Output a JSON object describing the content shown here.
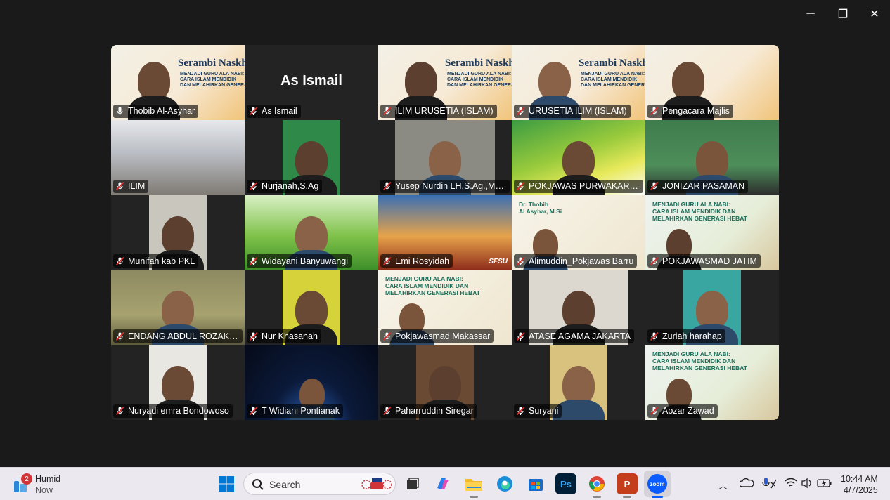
{
  "window": {
    "controls": {
      "minimize": "─",
      "maximize": "❐",
      "close": "✕"
    }
  },
  "meeting": {
    "highlight_color": "#35d07f",
    "participants": [
      {
        "name": "Thobib Al-Asyhar",
        "mic": "unmuted",
        "active": true,
        "bg": "banner",
        "banner_title": "Serambi Naskhah",
        "banner_sub": "MENJADI GURU ALA NABI:\nCARA ISLAM MENDIDIK\nDAN MELAHIRKAN GENERASI HEBAT"
      },
      {
        "name": "As Ismail",
        "mic": "muted",
        "active": false,
        "bg": "plain",
        "big_label": "As Ismail"
      },
      {
        "name": "ILIM URUSETIA (ISLAM)",
        "mic": "muted",
        "active": false,
        "bg": "banner",
        "banner_title": "Serambi Naskhah",
        "banner_sub": "MENJADI GURU ALA NABI:\nCARA ISLAM MENDIDIK\nDAN MELAHIRKAN GENERASI HEBAT"
      },
      {
        "name": "URUSETIA ILIM (ISLAM)",
        "mic": "muted",
        "active": false,
        "bg": "banner",
        "banner_title": "Serambi Naskhah",
        "banner_sub": "MENJADI GURU ALA NABI:\nCARA ISLAM MENDIDIK\nDAN MELAHIRKAN GENERASI HEBAT"
      },
      {
        "name": "Pengacara Majlis",
        "mic": "muted",
        "active": false,
        "bg": "banner-person"
      },
      {
        "name": "ILIM",
        "mic": "muted",
        "active": false,
        "bg": "hall"
      },
      {
        "name": "Nurjanah,S.Ag",
        "mic": "muted",
        "active": false,
        "bg": "narrow-green"
      },
      {
        "name": "Yusep Nurdin LH,S.Ag.,M.Pd....",
        "mic": "muted",
        "active": false,
        "bg": "narrow-room"
      },
      {
        "name": "POKJAWAS PURWAKARTA",
        "mic": "muted",
        "active": false,
        "bg": "green-wave"
      },
      {
        "name": "JONIZAR PASAMAN",
        "mic": "muted",
        "active": false,
        "bg": "room-green"
      },
      {
        "name": "Munifah kab PKL",
        "mic": "muted",
        "active": false,
        "bg": "narrow-hijab"
      },
      {
        "name": "Widayani Banyuwangi",
        "mic": "muted",
        "active": false,
        "bg": "grass"
      },
      {
        "name": "Emi Rosyidah",
        "mic": "muted",
        "active": false,
        "bg": "bridge",
        "corner_label": "SFSU"
      },
      {
        "name": "Alimuddin_Pokjawas Barru",
        "mic": "muted",
        "active": false,
        "bg": "poster",
        "banner_title": "Dr. Thobib\nAl Asyhar, M.Si"
      },
      {
        "name": "POKJAWASMAD JATIM",
        "mic": "muted",
        "active": false,
        "bg": "poster-person",
        "banner_title": "MENJADI GURU ALA NABI:\nCARA ISLAM MENDIDIK DAN\nMELAHIRKAN GENERASI HEBAT"
      },
      {
        "name": "ENDANG ABDUL ROZAK, S.P...",
        "mic": "muted",
        "active": false,
        "bg": "wall"
      },
      {
        "name": "Nur Khasanah",
        "mic": "muted",
        "active": false,
        "bg": "narrow-yellow"
      },
      {
        "name": "Pokjawasmad Makassar",
        "mic": "muted",
        "active": false,
        "bg": "poster",
        "banner_title": "MENJADI GURU ALA NABI:\nCARA ISLAM MENDIDIK DAN\nMELAHIRKAN GENERASI HEBAT"
      },
      {
        "name": "ATASE AGAMA JAKARTA",
        "mic": "muted",
        "active": false,
        "bg": "narrow-office"
      },
      {
        "name": "Zuriah harahap",
        "mic": "muted",
        "active": false,
        "bg": "narrow-teal"
      },
      {
        "name": "Nuryadi  emra Bondowoso",
        "mic": "muted",
        "active": false,
        "bg": "narrow-light"
      },
      {
        "name": "T Widiani Pontianak",
        "mic": "muted",
        "active": false,
        "bg": "space"
      },
      {
        "name": "Paharruddin Siregar",
        "mic": "muted",
        "active": false,
        "bg": "narrow-shelf"
      },
      {
        "name": "Suryani",
        "mic": "muted",
        "active": false,
        "bg": "narrow-beige"
      },
      {
        "name": "Aozar Zawad",
        "mic": "muted",
        "active": false,
        "bg": "poster-person",
        "banner_title": "MENJADI GURU ALA NABI:\nCARA ISLAM MENDIDIK DAN\nMELAHIRKAN GENERASI HEBAT"
      }
    ]
  },
  "taskbar": {
    "weather": {
      "title": "Humid",
      "subtitle": "Now",
      "badge": "2"
    },
    "search": {
      "label": "Search"
    },
    "apps": [
      {
        "name": "windows-start",
        "glyph": ""
      },
      {
        "name": "task-view",
        "glyph": ""
      },
      {
        "name": "copilot",
        "glyph": ""
      },
      {
        "name": "file-explorer",
        "glyph": ""
      },
      {
        "name": "edge",
        "glyph": ""
      },
      {
        "name": "microsoft-store",
        "glyph": ""
      },
      {
        "name": "photoshop",
        "glyph": "Ps"
      },
      {
        "name": "chrome",
        "glyph": ""
      },
      {
        "name": "powerpoint",
        "glyph": "P"
      },
      {
        "name": "zoom",
        "glyph": "zoom"
      }
    ],
    "clock": {
      "time": "10:44 AM",
      "date": "4/7/2025"
    },
    "colors": {
      "start": "#0078d4",
      "photoshop": "#001e36",
      "powerpoint": "#c43e1c",
      "zoom": "#0b5cff",
      "store": "#1b6ac9"
    }
  }
}
